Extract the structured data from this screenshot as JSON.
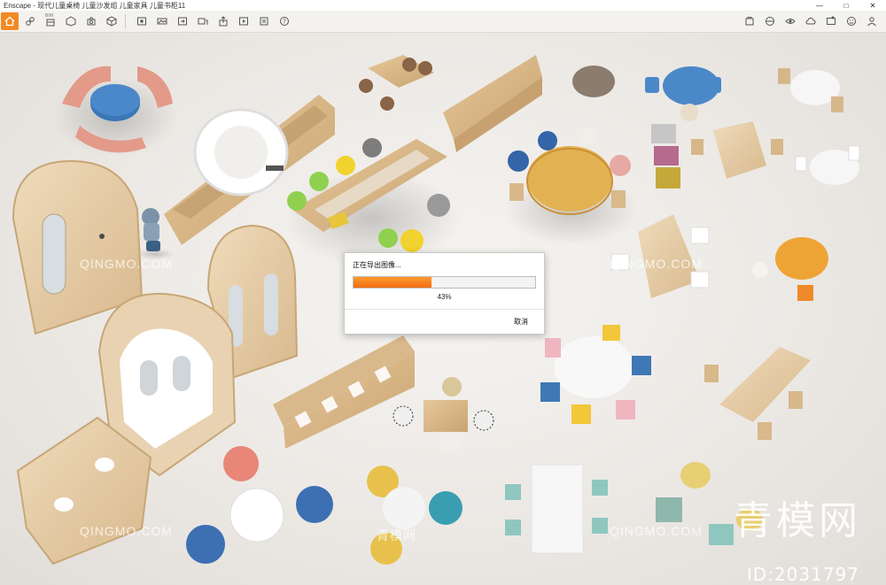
{
  "window": {
    "title": "Enscape - 现代儿童桌椅 儿童沙发组 儿童家具 儿童书柜11",
    "controls": {
      "minimize": "—",
      "maximize": "□",
      "close": "✕"
    }
  },
  "toolbar": {
    "left_icons": [
      "home-icon",
      "link-icon",
      "bim-icon",
      "object-icon",
      "capture-icon",
      "cube-icon",
      "view-icon",
      "panorama-icon",
      "export-icon",
      "batch-icon",
      "upload-icon",
      "video-icon",
      "settings-icon",
      "help-icon"
    ],
    "bim_label": "BIM",
    "right_icons": [
      "assets-icon",
      "materials-icon",
      "visual-settings-icon",
      "atmosphere-icon",
      "capture-settings-icon",
      "feedback-icon",
      "account-icon"
    ]
  },
  "dialog": {
    "title": "正在导出图像...",
    "progress": 0.43,
    "percent_label": "43%",
    "cancel_label": "取消",
    "accent": "#f26c0f"
  },
  "watermarks": {
    "brand_latin": "QINGMO.COM",
    "brand_cn": "青模网",
    "id_label": "ID:2031797"
  }
}
